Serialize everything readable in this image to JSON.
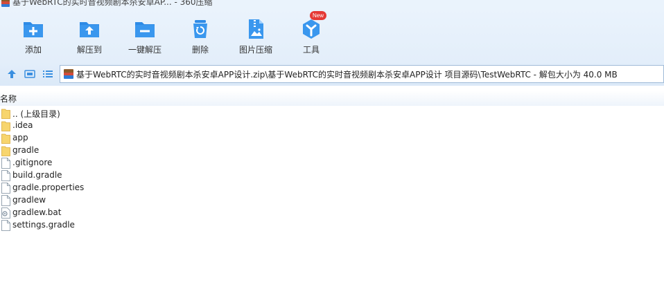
{
  "window": {
    "title": "基于WebRTC的实时音视频剧本杀安卓AP... - 360压缩"
  },
  "toolbar": {
    "buttons": [
      {
        "label": "添加",
        "icon": "add-icon"
      },
      {
        "label": "解压到",
        "icon": "extract-to-icon"
      },
      {
        "label": "一键解压",
        "icon": "one-click-extract-icon"
      },
      {
        "label": "删除",
        "icon": "delete-icon"
      },
      {
        "label": "图片压缩",
        "icon": "image-compress-icon"
      },
      {
        "label": "工具",
        "icon": "tools-icon",
        "badge": "New"
      }
    ]
  },
  "address": {
    "path": "基于WebRTC的实时音视频剧本杀安卓APP设计.zip\\基于WebRTC的实时音视频剧本杀安卓APP设计 项目源码\\TestWebRTC - 解包大小为 40.0 MB"
  },
  "columns": {
    "name": "名称"
  },
  "files": [
    {
      "name": ".. (上级目录)",
      "type": "folder"
    },
    {
      "name": ".idea",
      "type": "folder"
    },
    {
      "name": "app",
      "type": "folder"
    },
    {
      "name": "gradle",
      "type": "folder"
    },
    {
      "name": ".gitignore",
      "type": "file"
    },
    {
      "name": "build.gradle",
      "type": "file"
    },
    {
      "name": "gradle.properties",
      "type": "file"
    },
    {
      "name": "gradlew",
      "type": "file"
    },
    {
      "name": "gradlew.bat",
      "type": "batch"
    },
    {
      "name": "settings.gradle",
      "type": "file"
    }
  ],
  "colors": {
    "accent": "#2e8be6",
    "folder": "#f7d56e",
    "badge": "#e53935"
  }
}
